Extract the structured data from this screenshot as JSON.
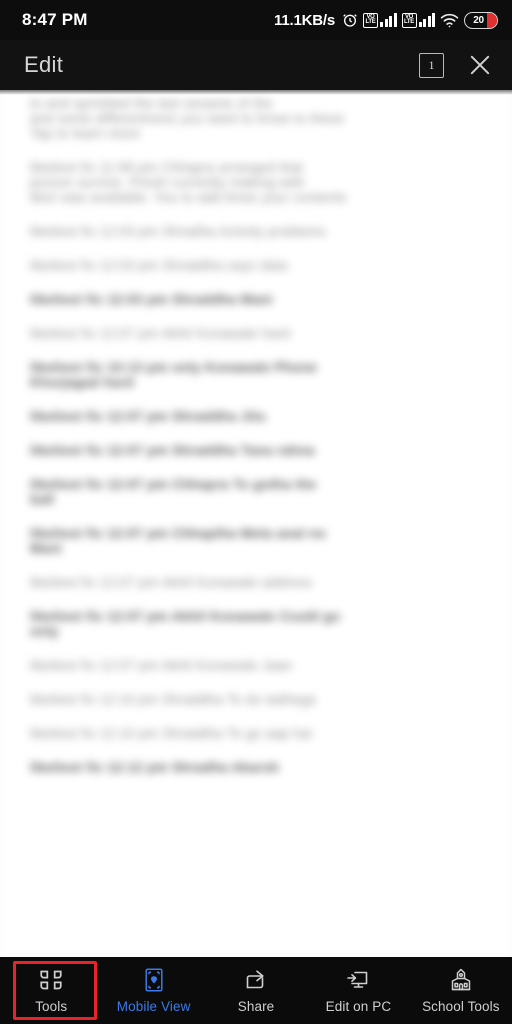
{
  "status_bar": {
    "time": "8:47 PM",
    "network_speed": "11.1KB/s",
    "alarm_icon": "alarm-clock-icon",
    "sim1_volte_label": "VO\nLTE",
    "sim1_volte_top": "VO",
    "sim1_volte_bottom": "LTE",
    "sim2_volte_top": "VO",
    "sim2_volte_bottom": "LTE",
    "wifi_icon": "wifi-icon",
    "battery_percent": "20",
    "battery_color": "#e03030"
  },
  "app_bar": {
    "title": "Edit",
    "page_count_badge": "1",
    "close_label": "close-icon"
  },
  "document": {
    "lines": [
      {
        "text": "to and sprinkled the last sesame of the",
        "bold": false
      },
      {
        "text": "and some differentness you want to know to these",
        "bold": false
      },
      {
        "text": "Tap to learn more",
        "bold": false
      },
      {
        "text": "",
        "bold": false
      },
      {
        "text": "likeliest fix    11:58 pm    Chhapra arranged that",
        "bold": false
      },
      {
        "text": "picture survive.  Finish currently making with",
        "bold": false
      },
      {
        "text": "Mon was available.  You to add three your contents",
        "bold": false
      },
      {
        "text": "",
        "bold": false
      },
      {
        "text": "likeliest fix 12:03 pm   Shradha  Activity problems",
        "bold": false
      },
      {
        "text": "",
        "bold": false
      },
      {
        "text": "likeliest fix   12:03 pm   Shraddha says data",
        "bold": false
      },
      {
        "text": "",
        "bold": false
      },
      {
        "text": "likeliest fix   12:03 pm   Shraddha Mani",
        "bold": true
      },
      {
        "text": "",
        "bold": false
      },
      {
        "text": "likeliest fix   12:07 pm   Akhil Konawale hard",
        "bold": false
      },
      {
        "text": "",
        "bold": false
      },
      {
        "text": "likeliest fix   10:13    pm      only  Konawale   Phone",
        "bold": true
      },
      {
        "text": "Khurjagad hard",
        "bold": true
      },
      {
        "text": "",
        "bold": false
      },
      {
        "text": "likeliest fix   12:07 pm   Shraddha Jitu",
        "bold": true
      },
      {
        "text": "",
        "bold": false
      },
      {
        "text": "likeliest fix   12:07 pm   Shraddha Tana rahna",
        "bold": true
      },
      {
        "text": "",
        "bold": false
      },
      {
        "text": "likeliest fix   12:07 pm    Chhapra   To gotha the",
        "bold": true
      },
      {
        "text": "ball",
        "bold": true
      },
      {
        "text": "",
        "bold": false
      },
      {
        "text": "likeliest fix   12:07 pm   Chhaptha Meta anal no",
        "bold": true
      },
      {
        "text": "Mani",
        "bold": true
      },
      {
        "text": "",
        "bold": false
      },
      {
        "text": "likeliest fix   12:07 pm   Akhil Konawale address",
        "bold": false
      },
      {
        "text": "",
        "bold": false
      },
      {
        "text": "likeliest fix   12:07 pm    Akhil Konawale  Could go",
        "bold": true
      },
      {
        "text": "only",
        "bold": true
      },
      {
        "text": "",
        "bold": false
      },
      {
        "text": "likeliest fix   12:07 pm   Akhil Konawale Jaan",
        "bold": false
      },
      {
        "text": "",
        "bold": false
      },
      {
        "text": "likeliest fix   12:10 pm   Shraddha To do ladhega",
        "bold": false
      },
      {
        "text": "",
        "bold": false
      },
      {
        "text": "likeliest fix   12:10 pm   Shraddha To go aap hai",
        "bold": false
      },
      {
        "text": "",
        "bold": false
      },
      {
        "text": "likeliest fix   12:12 pm   Shradha Akarsh",
        "bold": true
      }
    ]
  },
  "toolbar": {
    "items": [
      {
        "label": "Tools",
        "icon": "grid-tools-icon",
        "active": false,
        "highlighted": true
      },
      {
        "label": "Mobile View",
        "icon": "mobile-frame-icon",
        "active": true,
        "highlighted": false
      },
      {
        "label": "Share",
        "icon": "share-arrow-icon",
        "active": false,
        "highlighted": false
      },
      {
        "label": "Edit on PC",
        "icon": "monitor-edit-icon",
        "active": false,
        "highlighted": false
      },
      {
        "label": "School Tools",
        "icon": "school-icon",
        "active": false,
        "highlighted": false
      }
    ],
    "active_color": "#3d79e8",
    "highlight_color": "#e8232a"
  }
}
